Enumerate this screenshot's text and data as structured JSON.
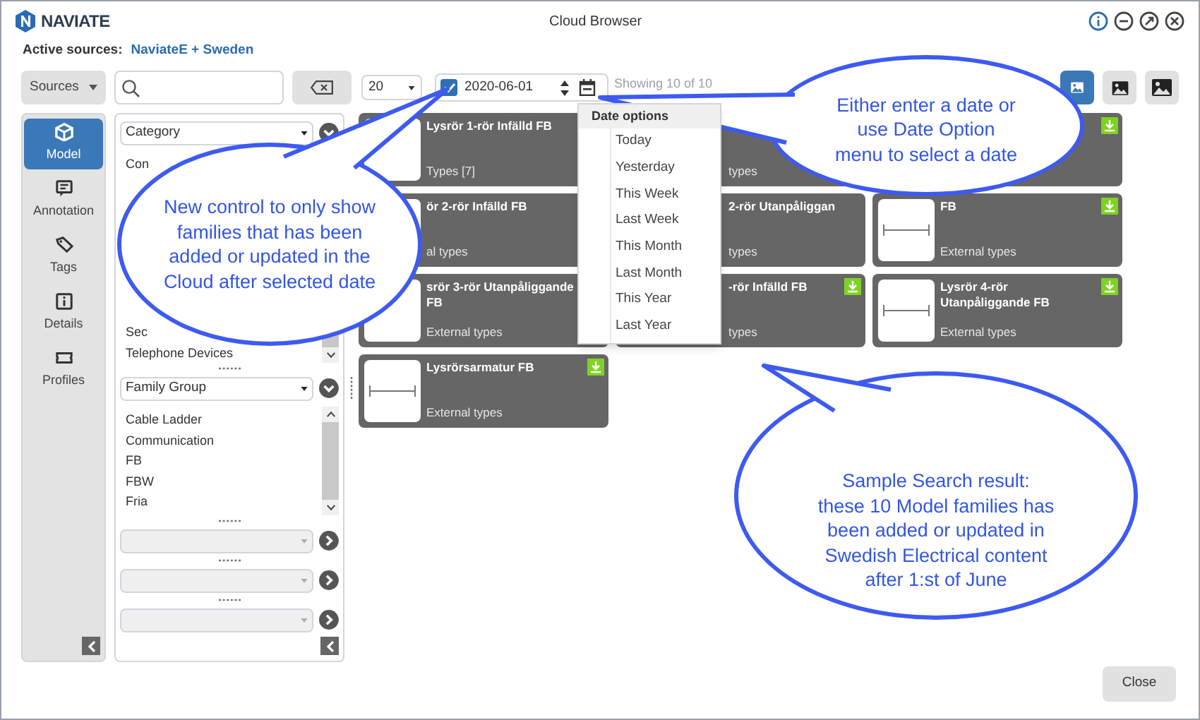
{
  "window": {
    "logo": "NAVIATE",
    "title": "Cloud Browser"
  },
  "active_sources": {
    "label": "Active sources:",
    "value": "NaviateE + Sweden"
  },
  "toolbar": {
    "sources": "Sources",
    "page_size": "20",
    "date_filter": {
      "checked": true,
      "value": "2020-06-01"
    },
    "result_count": "Showing 10 of 10",
    "view_sizes": [
      {
        "selected": true
      },
      {
        "selected": false
      },
      {
        "selected": false
      }
    ]
  },
  "nav": [
    {
      "label": "Model",
      "selected": true
    },
    {
      "label": "Annotation",
      "selected": false
    },
    {
      "label": "Tags",
      "selected": false
    },
    {
      "label": "Details",
      "selected": false
    },
    {
      "label": "Profiles",
      "selected": false
    }
  ],
  "filters": [
    {
      "label": "Category",
      "expanded": true,
      "items": [
        "Con",
        "Sec",
        "Telephone Devices"
      ]
    },
    {
      "label": "Family Group",
      "expanded": true,
      "items": [
        "Cable Ladder",
        "Communication",
        "FB",
        "FBW",
        "Fria"
      ]
    },
    {
      "expanded": false
    },
    {
      "expanded": false
    },
    {
      "expanded": false
    }
  ],
  "results": [
    [
      {
        "title": "Lysrör 1-rör Infälld FB",
        "subtitle": "Types [7]",
        "download": false
      },
      {
        "title": "ör 2-rör Infälld FB",
        "subtitle": "al types",
        "download": false
      },
      {
        "title": "srör 3-rör Utanpåliggande FB",
        "subtitle": "External types",
        "download": false
      },
      {
        "title": "Lysrörsarmatur FB",
        "subtitle": "External types",
        "download": true
      }
    ],
    [
      {
        "subtitle": "types",
        "download": false
      },
      {
        "title": "2-rör Utanpåliggan",
        "subtitle": "types",
        "download": false
      },
      {
        "title": "-rör Infälld FB",
        "subtitle": "types",
        "download": true
      }
    ],
    [
      {
        "download": true
      },
      {
        "title": "FB",
        "subtitle": "External types",
        "download": true
      },
      {
        "title": "Lysrör 4-rör Utanpåliggande FB",
        "subtitle": "External types",
        "download": true
      }
    ]
  ],
  "date_menu": {
    "title": "Date options",
    "items": [
      "Today",
      "Yesterday",
      "This Week",
      "Last Week",
      "This Month",
      "Last Month",
      "This Year",
      "Last Year"
    ]
  },
  "callouts": [
    {
      "text": "New control to only show\nfamilies that has been\nadded or updated in the\nCloud after selected date"
    },
    {
      "text": "Either enter a date or\nuse Date Option\nmenu to select a date"
    },
    {
      "text": "Sample Search result:\nthese 10 Model families has\nbeen added or updated in\nSwedish Electrical content\nafter 1:st of June"
    }
  ],
  "close_button": "Close"
}
